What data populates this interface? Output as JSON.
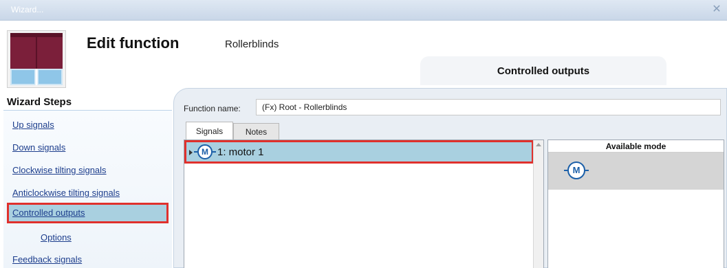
{
  "window": {
    "title": "Wizard..."
  },
  "header": {
    "title": "Edit function",
    "subtitle": "Rollerblinds",
    "section_tab": "Controlled outputs"
  },
  "nav": {
    "title": "Wizard Steps",
    "items": [
      {
        "label": "Up signals"
      },
      {
        "label": "Down signals"
      },
      {
        "label": "Clockwise tilting signals"
      },
      {
        "label": "Anticlockwise tilting signals"
      },
      {
        "label": "Controlled outputs",
        "selected": true
      },
      {
        "label": "Options"
      },
      {
        "label": "Feedback signals"
      }
    ]
  },
  "main": {
    "function_name_label": "Function name:",
    "function_name_value": "(Fx) Root - Rollerblinds",
    "tabs": [
      {
        "label": "Signals"
      },
      {
        "label": "Notes"
      }
    ],
    "signals": [
      {
        "label": "1: motor 1",
        "icon": "motor-icon"
      }
    ],
    "available_mode": {
      "header": "Available mode",
      "icon": "motor-icon",
      "icon_letter": "M"
    }
  },
  "colors": {
    "selection": "#a9d0e0",
    "highlight_border": "#e0302c",
    "motor_blue": "#1b5fa8"
  }
}
